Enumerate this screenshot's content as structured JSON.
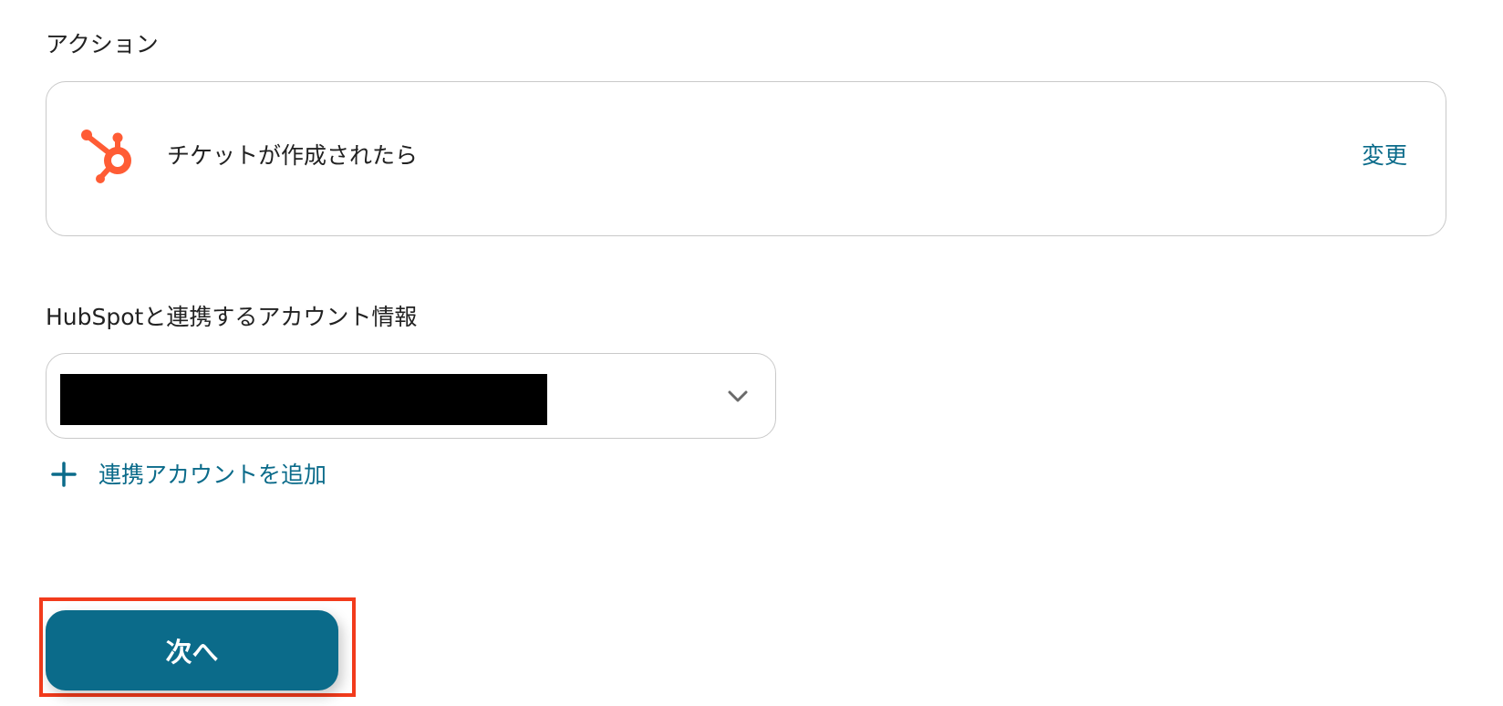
{
  "action_section": {
    "label": "アクション",
    "trigger_text": "チケットが作成されたら",
    "change_label": "変更",
    "icon": "hubspot-logo-icon"
  },
  "account_section": {
    "label": "HubSpotと連携するアカウント情報",
    "selected_value": "",
    "add_account_label": "連携アカウントを追加"
  },
  "footer": {
    "next_label": "次へ"
  },
  "colors": {
    "accent": "#0b6b8a",
    "hubspot_orange": "#ff5c35",
    "highlight_red": "#f23b1c",
    "border": "#c9c9c9"
  }
}
